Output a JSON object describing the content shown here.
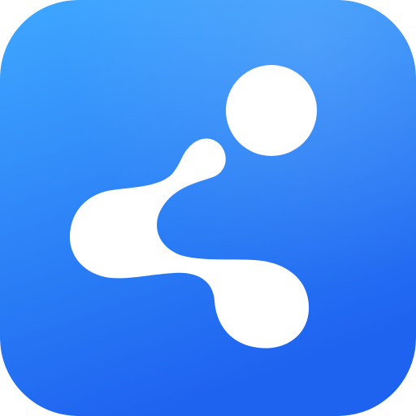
{
  "icon": {
    "name": "share-icon",
    "background_top": "#3FA8FF",
    "background_bottom": "#1E63F0",
    "glyph_color": "#FFFFFF"
  }
}
